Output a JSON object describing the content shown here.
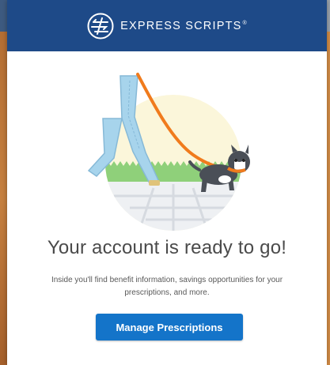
{
  "brand": {
    "name": "EXPRESS SCRIPTS",
    "registered_mark": "®",
    "header_color": "#1e4a88"
  },
  "hero": {
    "illustration": "person-walking-dog"
  },
  "content": {
    "title": "Your account is ready to go!",
    "description": "Inside you'll find benefit information, savings opportunities for your prescriptions, and more."
  },
  "actions": {
    "primary_label": "Manage Prescriptions",
    "primary_color": "#1474c9"
  }
}
